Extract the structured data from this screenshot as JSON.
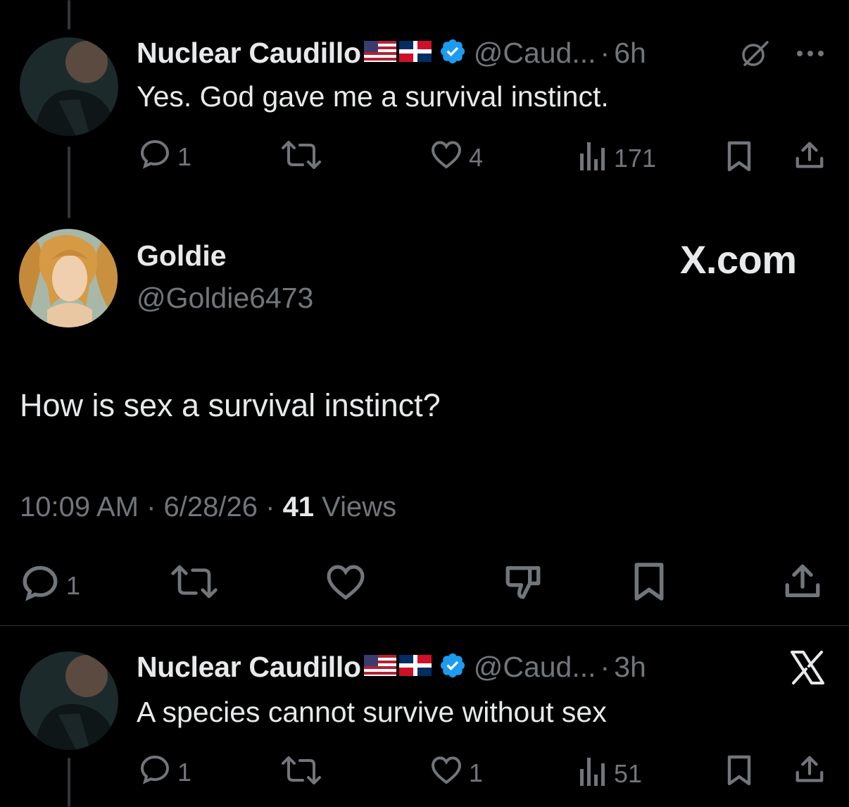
{
  "tweets": [
    {
      "name": "Nuclear Caudillo",
      "handle": "@Caud...",
      "time": "6h",
      "text": "Yes. God gave me a survival instinct.",
      "replies": "1",
      "likes": "4",
      "views": "171"
    },
    {
      "name": "Nuclear Caudillo",
      "handle": "@Caud...",
      "time": "3h",
      "text": "A species cannot survive without sex",
      "replies": "1",
      "likes": "1",
      "views": "51"
    }
  ],
  "main_post": {
    "name": "Goldie",
    "handle": "@Goldie6473",
    "brand": "X.com",
    "text": "How is sex a survival instinct?",
    "timestamp": "10:09 AM · 6/28/26 · ",
    "views_count": "41",
    "views_label": " Views",
    "replies": "1"
  },
  "separator": "·",
  "icons": {
    "reply": "reply-icon",
    "retweet": "retweet-icon",
    "like": "heart-icon",
    "views": "views-icon",
    "bookmark": "bookmark-icon",
    "share": "share-icon",
    "grok": "grok-icon",
    "more": "more-icon",
    "dislike": "dislike-icon",
    "x_logo": "x-logo-icon"
  },
  "colors": {
    "background": "#000000",
    "text": "#e7e9ea",
    "muted": "#71767b",
    "verified": "#1d9bf0"
  }
}
